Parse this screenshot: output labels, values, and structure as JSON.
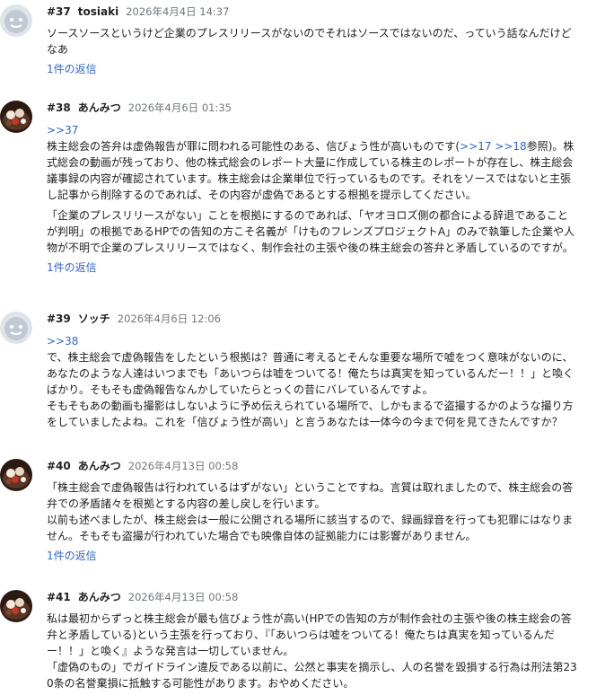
{
  "posts": [
    {
      "number": "#37",
      "author": "tosiaki",
      "date": "2026年4月4日 14:37",
      "avatar": "default-face-avatar",
      "quote": "",
      "lines": [
        "ソースソースというけど企業のプレスリリースがないのでそれはソースではないのだ、っていう話なんだけど",
        "なあ"
      ],
      "replies": "1件の返信"
    },
    {
      "number": "#38",
      "author": "あんみつ",
      "date": "2026年4月6日 01:35",
      "avatar": "anmitsu-food-avatar",
      "quote": ">>37",
      "line1_pre": "株主総会の答弁は虚偽報告が罪に問われる可能性のある、信びょう性が高いものです(",
      "line1_link1": ">>17",
      "line1_link2": ">>18",
      "line1_post": "参照)。株",
      "lines": [
        "式総会の動画が残っており、他の株式総会のレポート大量に作成している株主のレポートが存在し、株主総会",
        "議事録の内容が確認されています。株主総会は企業単位で行っているものです。それをソースではないと主張",
        "し記事から削除するのであれば、その内容が虚偽であるとする根拠を提示してください。"
      ],
      "lines2": [
        "「企業のプレスリリースがない」ことを根拠にするのであれば、「ヤオヨロズ側の都合による辞退であること",
        "が判明」の根拠であるHPでの告知の方こそ名義が「けものフレンズプロジェクトA」のみで執筆した企業や人",
        "物が不明で企業のプレスリリースではなく、制作会社の主張や後の株主総会の答弁と矛盾しているのですが。"
      ],
      "replies": "1件の返信"
    },
    {
      "number": "#39",
      "author": "ソッチ",
      "date": "2026年4月6日 12:06",
      "avatar": "default-face-avatar",
      "quote": ">>38",
      "lines": [
        "で、株主総会で虚偽報告をしたという根拠は？普通に考えるとそんな重要な場所で嘘をつく意味がないのに、",
        "あなたのような人達はいつまでも「あいつらは嘘をついてる！俺たちは真実を知っているんだー！！」と喚く",
        "ばかり。そもそも虚偽報告なんかしていたらとっくの昔にバレているんですよ。",
        "そもそもあの動画も撮影はしないように予め伝えられている場所で、しかもまるで盗撮するかのような撮り方",
        "をしていましたよね。これを「信びょう性が高い」と言うあなたは一体今の今まで何を見てきたんですか？"
      ],
      "replies": ""
    },
    {
      "number": "#40",
      "author": "あんみつ",
      "date": "2026年4月13日 00:58",
      "avatar": "anmitsu-food-avatar",
      "quote": "",
      "lines": [
        "「株主総会で虚偽報告は行われているはずがない」ということですね。言質は取れましたので、株主総会の答",
        "弁での矛盾諸々を根拠とする内容の差し戻しを行います。",
        "以前も述べましたが、株主総会は一般に公開される場所に該当するので、録画録音を行っても犯罪にはなりま",
        "せん。そもそも盗撮が行われていた場合でも映像自体の証拠能力には影響がありません。"
      ],
      "replies": "1件の返信"
    },
    {
      "number": "#41",
      "author": "あんみつ",
      "date": "2026年4月13日 00:58",
      "avatar": "anmitsu-food-avatar",
      "quote": "",
      "lines": [
        "私は最初からずっと株主総会が最も信びょう性が高い(HPでの告知の方が制作会社の主張や後の株主総会の答",
        "弁と矛盾している)という主張を行っており、『「あいつらは嘘をついてる！俺たちは真実を知っているんだ",
        "ー！！」と喚く』ような発言は一切していません。",
        "「虚偽のもの」でガイドライン違反である以前に、公然と事実を摘示し、人の名誉を毀損する行為は刑法第23",
        "0条の名誉棄損に抵触する可能性があります。おやめください。"
      ],
      "replies": ""
    }
  ]
}
